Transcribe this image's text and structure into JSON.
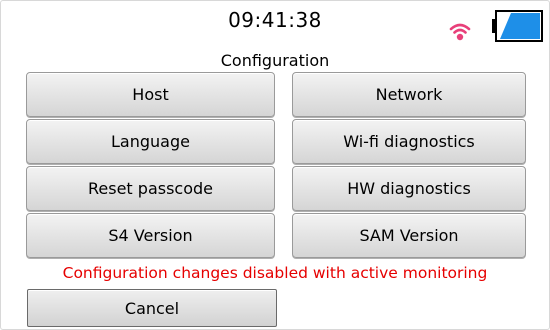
{
  "header": {
    "time": "09:41:38",
    "title": "Configuration"
  },
  "status_icons": {
    "wifi": "wifi-signal-icon",
    "wifi_color": "#e8407a",
    "battery": "battery-icon",
    "battery_color": "#1e8fe8"
  },
  "buttons": {
    "host": "Host",
    "network": "Network",
    "language": "Language",
    "wifi_diagnostics": "Wi-fi diagnostics",
    "reset_passcode": "Reset passcode",
    "hw_diagnostics": "HW diagnostics",
    "s4_version": "S4 Version",
    "sam_version": "SAM Version"
  },
  "warning": {
    "text": "Configuration changes disabled with active monitoring",
    "color": "#e60000"
  },
  "footer": {
    "cancel_label": "Cancel"
  }
}
